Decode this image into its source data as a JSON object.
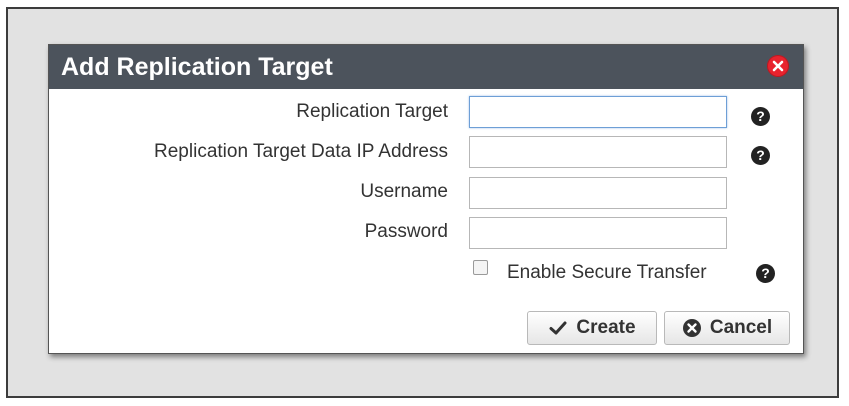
{
  "dialog": {
    "title": "Add Replication Target"
  },
  "form": {
    "replication_target_label": "Replication Target",
    "replication_target_value": "",
    "data_ip_label": "Replication Target Data IP Address",
    "data_ip_value": "",
    "username_label": "Username",
    "username_value": "",
    "password_label": "Password",
    "password_value": "",
    "secure_transfer_label": "Enable Secure Transfer",
    "secure_transfer_checked": false,
    "help_glyph": "?"
  },
  "buttons": {
    "create_label": "Create",
    "cancel_label": "Cancel"
  },
  "icons": {
    "close": "close-icon",
    "help": "question-circle-icon",
    "create": "checkmark-icon",
    "cancel": "times-circle-icon"
  },
  "colors": {
    "titlebar": "#4c535c",
    "close": "#e8232e",
    "input_focus_border": "#6e9fd6"
  }
}
